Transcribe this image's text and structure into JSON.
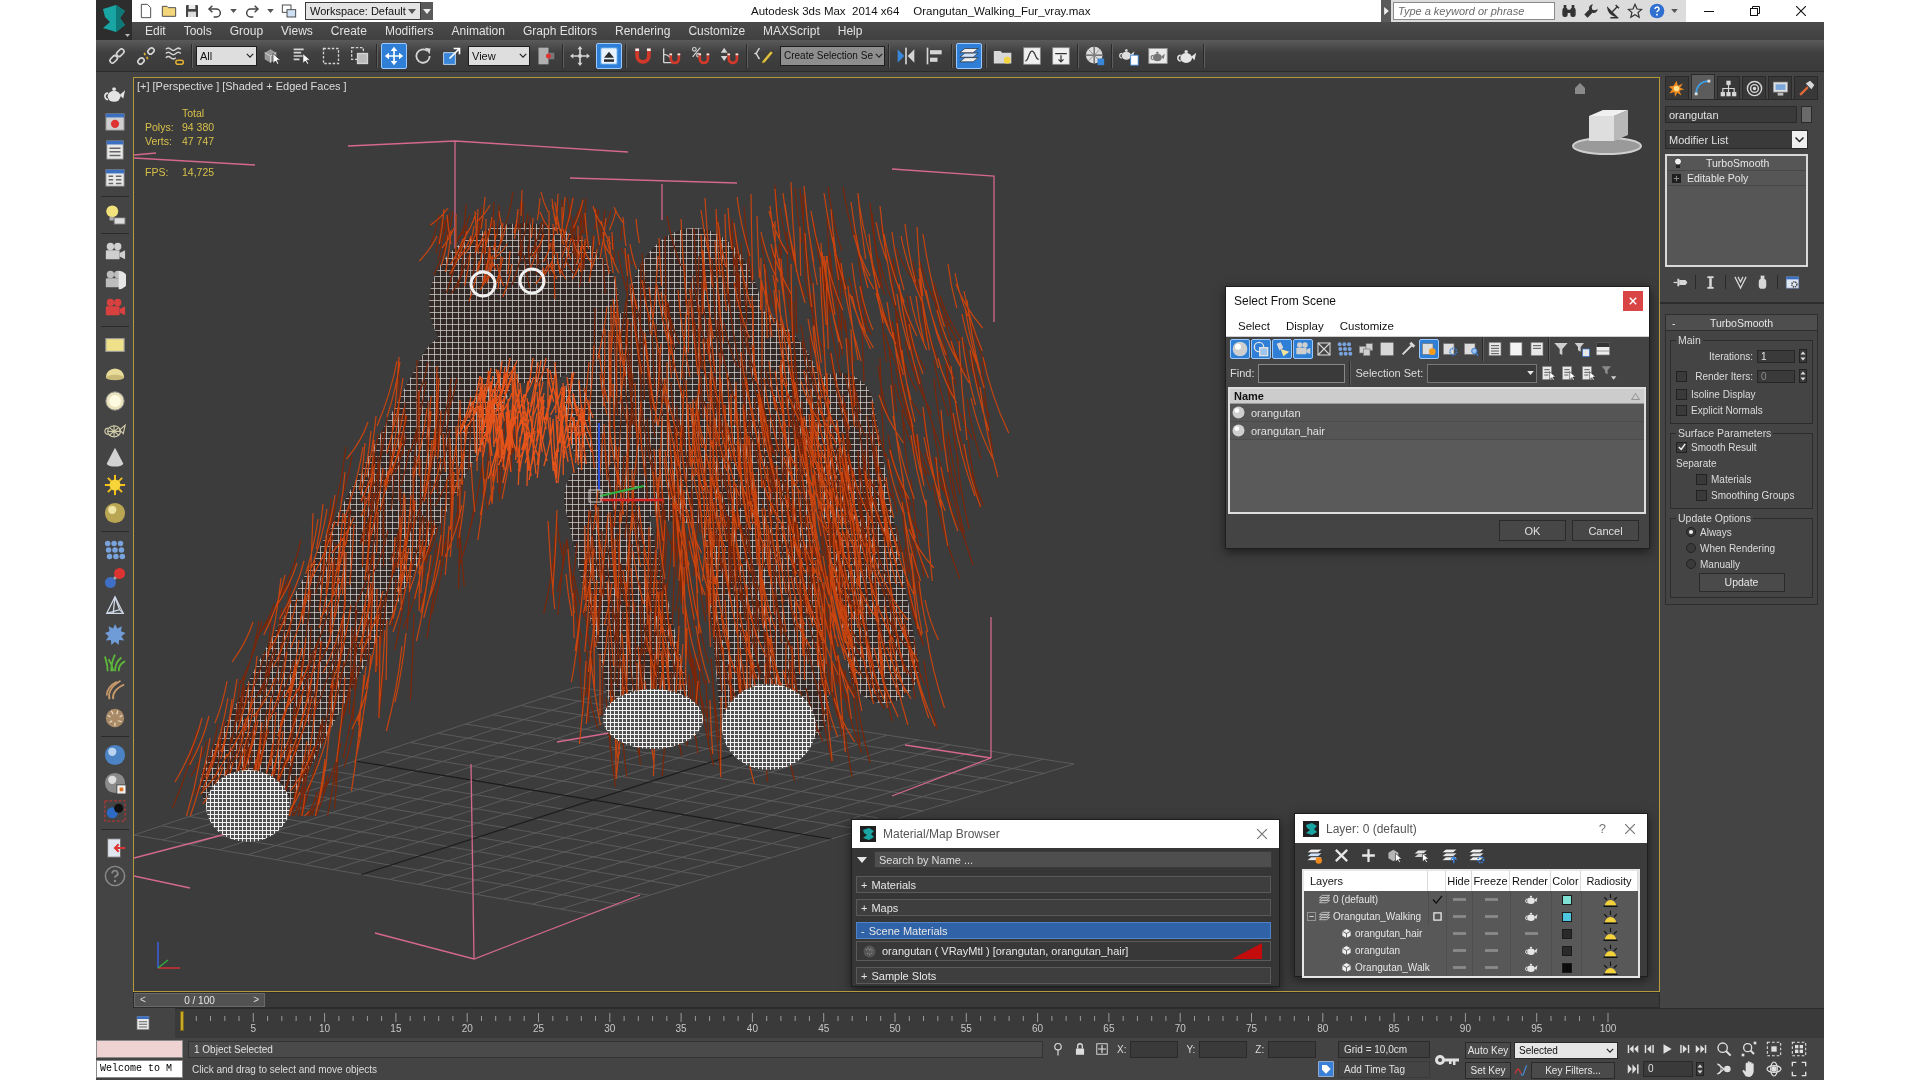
{
  "title_bar": {
    "workspace": "Workspace: Default",
    "app_title": "Autodesk 3ds Max  2014 x64",
    "file_name": "Orangutan_Walking_Fur_vray.max",
    "search": {
      "placeholder": "Type a keyword or phrase"
    }
  },
  "menu": [
    "Edit",
    "Tools",
    "Group",
    "Views",
    "Create",
    "Modifiers",
    "Animation",
    "Graph Editors",
    "Rendering",
    "Customize",
    "MAXScript",
    "Help"
  ],
  "main_toolbar": [
    {
      "kind": "tool",
      "selected": false
    },
    {
      "kind": "tool",
      "selected": false
    },
    {
      "kind": "tool",
      "selected": false
    },
    {
      "kind": "dropdown",
      "value": "All"
    },
    {
      "kind": "tool",
      "selected": false
    },
    {
      "kind": "tool",
      "selected": false
    },
    {
      "kind": "tool",
      "selected": false
    },
    {
      "kind": "tool",
      "selected": false
    },
    {
      "kind": "tool",
      "selected": true
    },
    {
      "kind": "tool",
      "selected": false
    },
    {
      "kind": "tool",
      "selected": false
    },
    {
      "kind": "dropdown",
      "value": "View"
    },
    {
      "kind": "tool",
      "selected": false
    },
    {
      "kind": "tool",
      "selected": false
    },
    {
      "kind": "tool",
      "selected": true
    },
    {
      "kind": "tool",
      "selected": false
    },
    {
      "kind": "tool",
      "selected": false
    },
    {
      "kind": "tool",
      "selected": false
    },
    {
      "kind": "tool",
      "selected": false
    },
    {
      "kind": "tool",
      "selected": false
    },
    {
      "kind": "dropdown",
      "value": "Create Selection Se"
    },
    {
      "kind": "tool",
      "selected": false
    },
    {
      "kind": "tool",
      "selected": false
    },
    {
      "kind": "tool",
      "selected": true
    },
    {
      "kind": "tool",
      "selected": false
    },
    {
      "kind": "tool",
      "selected": false
    },
    {
      "kind": "tool",
      "selected": false
    },
    {
      "kind": "tool",
      "selected": false
    },
    {
      "kind": "tool",
      "selected": false
    },
    {
      "kind": "tool",
      "selected": false
    },
    {
      "kind": "tool",
      "selected": false
    }
  ],
  "viewport": {
    "labels": [
      "[+]",
      "[Perspective ]",
      "[Shaded + Edged Faces ]"
    ],
    "stats": {
      "heading": "Total",
      "rows": [
        {
          "label": "Polys:",
          "value": "94 380"
        },
        {
          "label": "Verts:",
          "value": "47 747"
        },
        {
          "label": "FPS:",
          "value": "14,725"
        }
      ]
    }
  },
  "select_from_scene": {
    "title": "Select From Scene",
    "menu": [
      "Select",
      "Display",
      "Customize"
    ],
    "toolbar": [
      {
        "selected": true
      },
      {
        "selected": true
      },
      {
        "selected": true
      },
      {
        "selected": true
      },
      {
        "selected": false
      },
      {
        "selected": false
      },
      {
        "selected": false
      },
      {
        "selected": false
      },
      {
        "selected": false
      },
      {
        "selected": true
      },
      {
        "selected": false
      },
      {
        "selected": false
      },
      {
        "selected": false
      },
      {
        "selected": false
      },
      {
        "selected": false
      },
      {
        "selected": false
      },
      {
        "selected": false
      },
      {
        "selected": false
      }
    ],
    "find_label": "Find:",
    "selection_set_label": "Selection Set:",
    "column": "Name",
    "rows": [
      {
        "name": "orangutan",
        "selected": false
      },
      {
        "name": "orangutan_hair",
        "selected": false
      }
    ],
    "buttons": [
      "OK",
      "Cancel"
    ]
  },
  "material_browser": {
    "title": "Material/Map Browser",
    "search": {
      "placeholder": "Search by Name ..."
    },
    "groups": [
      {
        "sign": "+",
        "label": "Materials",
        "selected": false
      },
      {
        "sign": "+",
        "label": "Maps",
        "selected": false
      },
      {
        "sign": "-",
        "label": "Scene Materials",
        "selected": true,
        "items": [
          {
            "label": "orangutan ( VRayMtl ) [orangutan, orangutan_hair]"
          }
        ]
      },
      {
        "sign": "+",
        "label": "Sample Slots",
        "selected": false
      }
    ]
  },
  "layer_manager": {
    "title": "Layer: 0 (default)",
    "help": "?",
    "columns": [
      "Layers",
      "Hide",
      "Freeze",
      "Render",
      "Color",
      "Radiosity"
    ],
    "layers": [
      {
        "name": "0 (default)",
        "current": true,
        "hidden": false,
        "frozen": false,
        "renderable": true,
        "color": "#7fe0d4"
      },
      {
        "name": "Orangutan_Walking",
        "current": false,
        "expanded": true,
        "hidden": false,
        "frozen": false,
        "renderable": true,
        "color": "#4fc6e0",
        "children": [
          {
            "name": "orangutan_hair",
            "hidden": false,
            "frozen": false,
            "renderable": false,
            "color": "#2a2a2a"
          },
          {
            "name": "orangutan",
            "hidden": false,
            "frozen": false,
            "renderable": true,
            "color": "#2a2a2a"
          },
          {
            "name": "Orangutan_Walk",
            "hidden": false,
            "frozen": false,
            "renderable": true,
            "color": "#0c0c0c"
          }
        ]
      }
    ]
  },
  "command_panel": {
    "tabs": [
      {
        "selected": false
      },
      {
        "selected": true
      },
      {
        "selected": false
      },
      {
        "selected": false
      },
      {
        "selected": false
      },
      {
        "selected": false
      }
    ],
    "object_name": "orangutan",
    "modifier_list": "Modifier List",
    "stack": [
      {
        "kind": "modifier",
        "label": "TurboSmooth"
      },
      {
        "kind": "object",
        "label": "Editable Poly"
      }
    ],
    "rollout": {
      "sign": "-",
      "title": "TurboSmooth",
      "groups": [
        {
          "title": "Main",
          "controls": [
            {
              "kind": "spinner",
              "label": "Iterations:",
              "value": "1"
            },
            {
              "kind": "check_spinner",
              "label": "Render Iters:",
              "value": "0",
              "checked": false
            },
            {
              "kind": "checkbox",
              "label": "Isoline Display",
              "checked": false
            },
            {
              "kind": "checkbox",
              "label": "Explicit Normals",
              "checked": false
            }
          ]
        },
        {
          "title": "Surface Parameters",
          "controls": [
            {
              "kind": "checkbox",
              "label": "Smooth Result",
              "checked": true
            },
            {
              "kind": "label",
              "text": "Separate"
            },
            {
              "kind": "subcheckbox",
              "label": "Materials",
              "checked": false
            },
            {
              "kind": "subcheckbox",
              "label": "Smoothing Groups",
              "checked": false
            }
          ]
        },
        {
          "title": "Update Options",
          "controls": [
            {
              "kind": "radio",
              "label": "Always",
              "selected": true
            },
            {
              "kind": "radio",
              "label": "When Rendering",
              "selected": false
            },
            {
              "kind": "radio",
              "label": "Manually",
              "selected": false
            },
            {
              "kind": "button",
              "label": "Update"
            }
          ]
        }
      ]
    }
  },
  "time_slider": {
    "prev": "<",
    "label": "0 / 100",
    "next": ">",
    "level": 0
  },
  "track_bar": {
    "labels": [
      "5",
      "10",
      "15",
      "20",
      "25",
      "30",
      "35",
      "40",
      "45",
      "50",
      "55",
      "60",
      "65",
      "70",
      "75",
      "80",
      "85",
      "90",
      "95",
      "100"
    ]
  },
  "status_bar": {
    "listener": "Welcome to M",
    "prompt": "1 Object Selected",
    "hint": "Click and drag to select and move objects",
    "coords": [
      "X:",
      "Y:",
      "Z:"
    ],
    "grid": "Grid = 10,0cm",
    "time_tag": "Add Time Tag",
    "auto_key": {
      "label": "Auto Key",
      "on": false
    },
    "key_mode": "Selected",
    "set_key": "Set Key",
    "key_filters": "Key Filters...",
    "frame": "0"
  }
}
